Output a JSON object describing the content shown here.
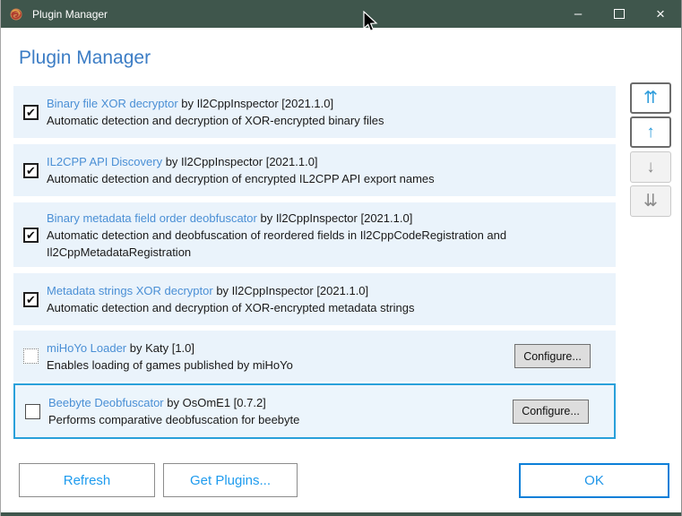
{
  "window": {
    "title": "Plugin Manager",
    "minimize_glyph": "–",
    "close_glyph": "×"
  },
  "header": {
    "title": "Plugin Manager"
  },
  "plugins": [
    {
      "name": "Binary file XOR decryptor",
      "byline": "by Il2CppInspector [2021.1.0]",
      "description": "Automatic detection and decryption of XOR-encrypted binary files",
      "checkbox": "checked",
      "has_configure": false,
      "selected": false
    },
    {
      "name": "IL2CPP API Discovery",
      "byline": "by Il2CppInspector [2021.1.0]",
      "description": "Automatic detection and decryption of encrypted IL2CPP API export names",
      "checkbox": "checked",
      "has_configure": false,
      "selected": false
    },
    {
      "name": "Binary metadata field order deobfuscator",
      "byline": "by Il2CppInspector [2021.1.0]",
      "description": "Automatic detection and deobfuscation of reordered fields in Il2CppCodeRegistration and Il2CppMetadataRegistration",
      "checkbox": "checked",
      "has_configure": false,
      "selected": false
    },
    {
      "name": "Metadata strings XOR decryptor",
      "byline": "by Il2CppInspector [2021.1.0]",
      "description": "Automatic detection and decryption of XOR-encrypted metadata strings",
      "checkbox": "checked",
      "has_configure": false,
      "selected": false
    },
    {
      "name": "miHoYo Loader",
      "byline": "by Katy [1.0]",
      "description": "Enables loading of games published by miHoYo",
      "checkbox": "indeterminate",
      "has_configure": true,
      "selected": false
    },
    {
      "name": "Beebyte Deobfuscator",
      "byline": "by OsOmE1 [0.7.2]",
      "description": "Performs comparative deobfuscation for beebyte",
      "checkbox": "unchecked",
      "has_configure": true,
      "selected": true
    }
  ],
  "configure_label": "Configure...",
  "checkmark_glyph": "✔",
  "order_buttons": [
    {
      "name": "move-to-top",
      "glyph": "⇈",
      "enabled": true
    },
    {
      "name": "move-up",
      "glyph": "↑",
      "enabled": true
    },
    {
      "name": "move-down",
      "glyph": "↓",
      "enabled": false
    },
    {
      "name": "move-to-bottom",
      "glyph": "⇊",
      "enabled": false
    }
  ],
  "footer": {
    "refresh_label": "Refresh",
    "get_plugins_label": "Get Plugins...",
    "ok_label": "OK"
  },
  "colors": {
    "titlebar": "#3F564C",
    "heading": "#3C7DC5",
    "plugin_link": "#4A8FD5",
    "row_background": "#EAF3FB",
    "selected_border": "#29A0DA",
    "accent_blue": "#1E9BEE"
  }
}
